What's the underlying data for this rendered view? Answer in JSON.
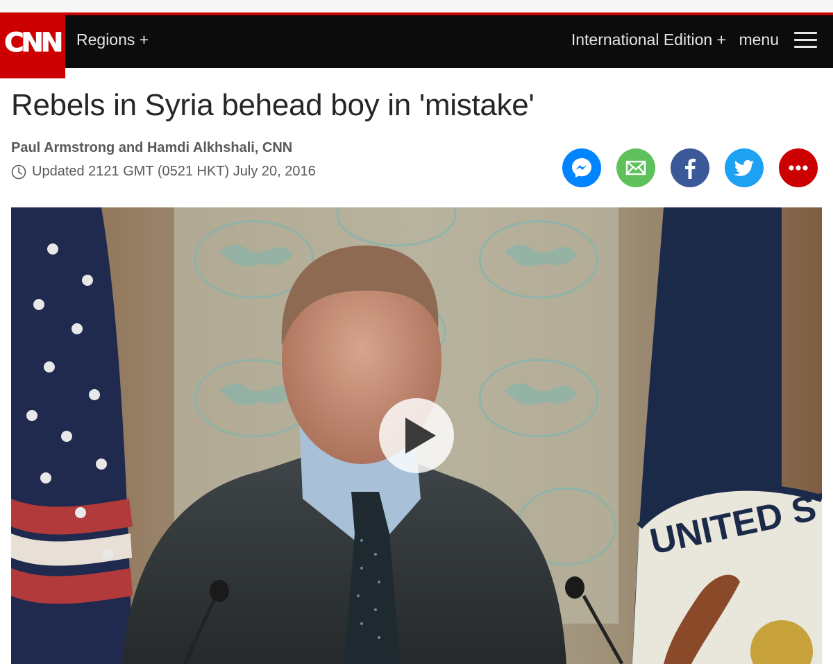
{
  "header": {
    "logo": "CNN",
    "regions_label": "Regions +",
    "edition_label": "International Edition +",
    "menu_label": "menu",
    "menu_icon": "hamburger-icon"
  },
  "article": {
    "headline": "Rebels in Syria behead boy in 'mistake'",
    "byline": "Paul Armstrong and Hamdi Alkhshali, CNN",
    "timestamp": "Updated 2121 GMT (0521 HKT) July 20, 2016"
  },
  "share_buttons": [
    {
      "icon": "messenger-icon",
      "color": "#0084ff"
    },
    {
      "icon": "email-icon",
      "color": "#5fc15c"
    },
    {
      "icon": "facebook-icon",
      "color": "#3b5998"
    },
    {
      "icon": "twitter-icon",
      "color": "#1da1f2"
    },
    {
      "icon": "more-icon",
      "color": "#cc0000"
    }
  ],
  "video": {
    "play_icon": "play-icon",
    "seal_text": "UNITED STA"
  },
  "colors": {
    "brand_red": "#cc0000",
    "nav_background": "#0c0c0c"
  }
}
